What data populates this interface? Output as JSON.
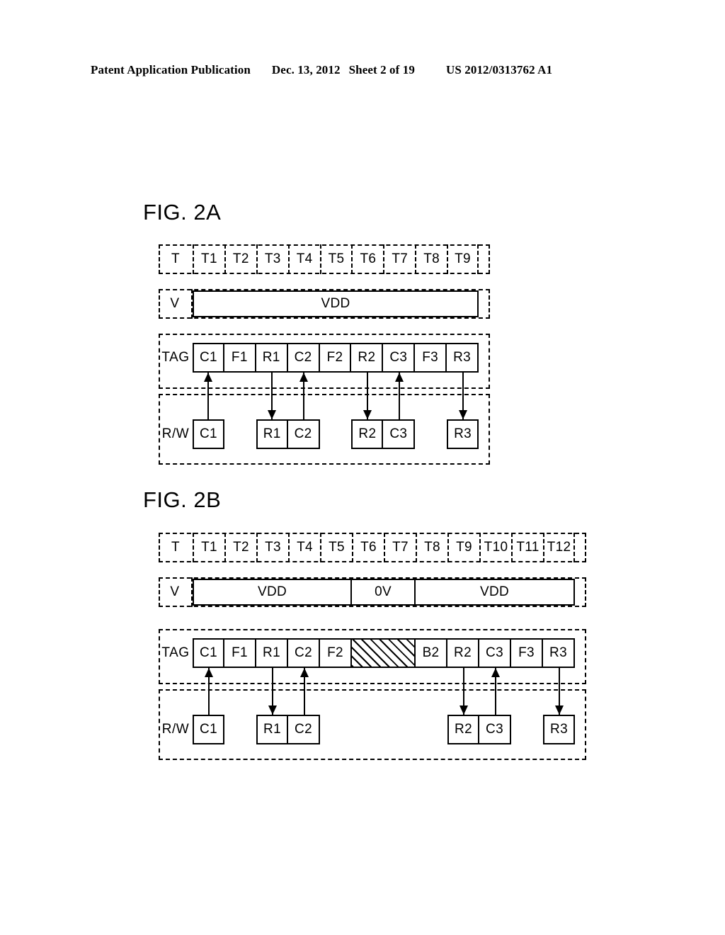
{
  "header": {
    "publication": "Patent Application Publication",
    "date": "Dec. 13, 2012",
    "sheet": "Sheet 2 of 19",
    "document_number": "US 2012/0313762 A1"
  },
  "figures": [
    {
      "id": "fig2a",
      "title": "FIG. 2A",
      "time_row": {
        "label": "T",
        "cells": [
          "T1",
          "T2",
          "T3",
          "T4",
          "T5",
          "T6",
          "T7",
          "T8",
          "T9"
        ]
      },
      "voltage_row": {
        "label": "V",
        "segments": [
          {
            "text": "VDD",
            "start": 1,
            "span": 9
          }
        ]
      },
      "tag_row": {
        "label": "TAG",
        "cells": [
          {
            "text": "C1",
            "start": 1,
            "span": 1,
            "hatched": false
          },
          {
            "text": "F1",
            "start": 2,
            "span": 1,
            "hatched": false
          },
          {
            "text": "R1",
            "start": 3,
            "span": 1,
            "hatched": false
          },
          {
            "text": "C2",
            "start": 4,
            "span": 1,
            "hatched": false
          },
          {
            "text": "F2",
            "start": 5,
            "span": 1,
            "hatched": false
          },
          {
            "text": "R2",
            "start": 6,
            "span": 1,
            "hatched": false
          },
          {
            "text": "C3",
            "start": 7,
            "span": 1,
            "hatched": false
          },
          {
            "text": "F3",
            "start": 8,
            "span": 1,
            "hatched": false
          },
          {
            "text": "R3",
            "start": 9,
            "span": 1,
            "hatched": false
          }
        ]
      },
      "rw_row": {
        "label": "R/W",
        "groups": [
          {
            "start": 1,
            "cells": [
              "C1"
            ]
          },
          {
            "start": 3,
            "cells": [
              "R1",
              "C2"
            ]
          },
          {
            "start": 6,
            "cells": [
              "R2",
              "C3"
            ]
          },
          {
            "start": 9,
            "cells": [
              "R3"
            ]
          }
        ]
      },
      "arrows": [
        {
          "col": 1,
          "direction": "up"
        },
        {
          "col": 3,
          "direction": "down"
        },
        {
          "col": 4,
          "direction": "up"
        },
        {
          "col": 6,
          "direction": "down"
        },
        {
          "col": 7,
          "direction": "up"
        },
        {
          "col": 9,
          "direction": "down"
        }
      ]
    },
    {
      "id": "fig2b",
      "title": "FIG. 2B",
      "time_row": {
        "label": "T",
        "cells": [
          "T1",
          "T2",
          "T3",
          "T4",
          "T5",
          "T6",
          "T7",
          "T8",
          "T9",
          "T10",
          "T11",
          "T12"
        ]
      },
      "voltage_row": {
        "label": "V",
        "segments": [
          {
            "text": "VDD",
            "start": 1,
            "span": 5
          },
          {
            "text": "0V",
            "start": 6,
            "span": 2
          },
          {
            "text": "VDD",
            "start": 8,
            "span": 5
          }
        ]
      },
      "tag_row": {
        "label": "TAG",
        "cells": [
          {
            "text": "C1",
            "start": 1,
            "span": 1,
            "hatched": false
          },
          {
            "text": "F1",
            "start": 2,
            "span": 1,
            "hatched": false
          },
          {
            "text": "R1",
            "start": 3,
            "span": 1,
            "hatched": false
          },
          {
            "text": "C2",
            "start": 4,
            "span": 1,
            "hatched": false
          },
          {
            "text": "F2",
            "start": 5,
            "span": 1,
            "hatched": false
          },
          {
            "text": "",
            "start": 6,
            "span": 2,
            "hatched": true
          },
          {
            "text": "B2",
            "start": 8,
            "span": 1,
            "hatched": false
          },
          {
            "text": "R2",
            "start": 9,
            "span": 1,
            "hatched": false
          },
          {
            "text": "C3",
            "start": 10,
            "span": 1,
            "hatched": false
          },
          {
            "text": "F3",
            "start": 11,
            "span": 1,
            "hatched": false
          },
          {
            "text": "R3",
            "start": 12,
            "span": 1,
            "hatched": false
          }
        ]
      },
      "rw_row": {
        "label": "R/W",
        "groups": [
          {
            "start": 1,
            "cells": [
              "C1"
            ]
          },
          {
            "start": 3,
            "cells": [
              "R1",
              "C2"
            ]
          },
          {
            "start": 9,
            "cells": [
              "R2",
              "C3"
            ]
          },
          {
            "start": 12,
            "cells": [
              "R3"
            ]
          }
        ]
      },
      "arrows": [
        {
          "col": 1,
          "direction": "up"
        },
        {
          "col": 3,
          "direction": "down"
        },
        {
          "col": 4,
          "direction": "up"
        },
        {
          "col": 9,
          "direction": "down"
        },
        {
          "col": 10,
          "direction": "up"
        },
        {
          "col": 12,
          "direction": "down"
        }
      ]
    }
  ]
}
